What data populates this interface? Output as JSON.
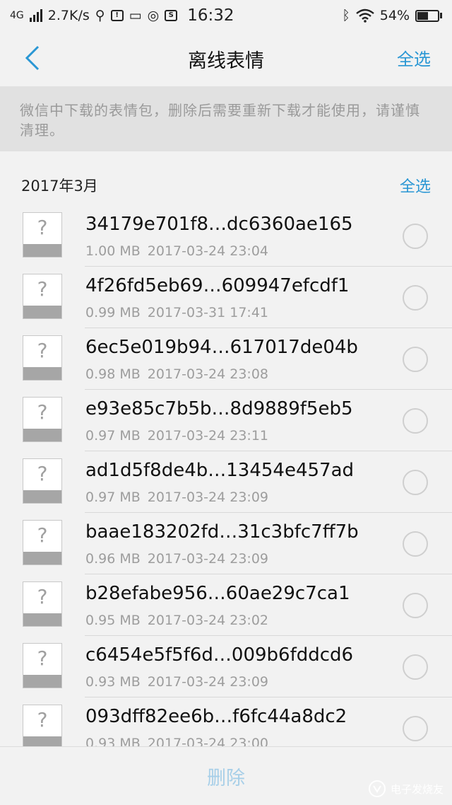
{
  "status_bar": {
    "network": "4G",
    "speed": "2.7K/s",
    "time": "16:32",
    "battery": "54%",
    "battery_level": 0.54
  },
  "nav": {
    "title": "离线表情",
    "select_all": "全选"
  },
  "notice": "微信中下载的表情包，删除后需要重新下载才能使用，请谨慎清理。",
  "section": {
    "title": "2017年3月",
    "select_all": "全选"
  },
  "items": [
    {
      "name": "34179e701f8…dc6360ae165",
      "size": "1.00 MB",
      "date": "2017-03-24 23:04"
    },
    {
      "name": "4f26fd5eb69…609947efcdf1",
      "size": "0.99 MB",
      "date": "2017-03-31 17:41"
    },
    {
      "name": "6ec5e019b94…617017de04b",
      "size": "0.98 MB",
      "date": "2017-03-24 23:08"
    },
    {
      "name": "e93e85c7b5b…8d9889f5eb5",
      "size": "0.97 MB",
      "date": "2017-03-24 23:11"
    },
    {
      "name": "ad1d5f8de4b…13454e457ad",
      "size": "0.97 MB",
      "date": "2017-03-24 23:09"
    },
    {
      "name": "baae183202fd…31c3bfc7ff7b",
      "size": "0.96 MB",
      "date": "2017-03-24 23:09"
    },
    {
      "name": "b28efabe956…60ae29c7ca1",
      "size": "0.95 MB",
      "date": "2017-03-24 23:02"
    },
    {
      "name": "c6454e5f5f6d…009b6fddcd6",
      "size": "0.93 MB",
      "date": "2017-03-24 23:09"
    },
    {
      "name": "093dff82ee6b…f6fc44a8dc2",
      "size": "0.93 MB",
      "date": "2017-03-24 23:00"
    }
  ],
  "bottom": {
    "delete_label": "删除"
  },
  "watermark": "电子发烧友",
  "colors": {
    "accent": "#2a97d4",
    "delete_disabled": "#a7cfe8"
  }
}
